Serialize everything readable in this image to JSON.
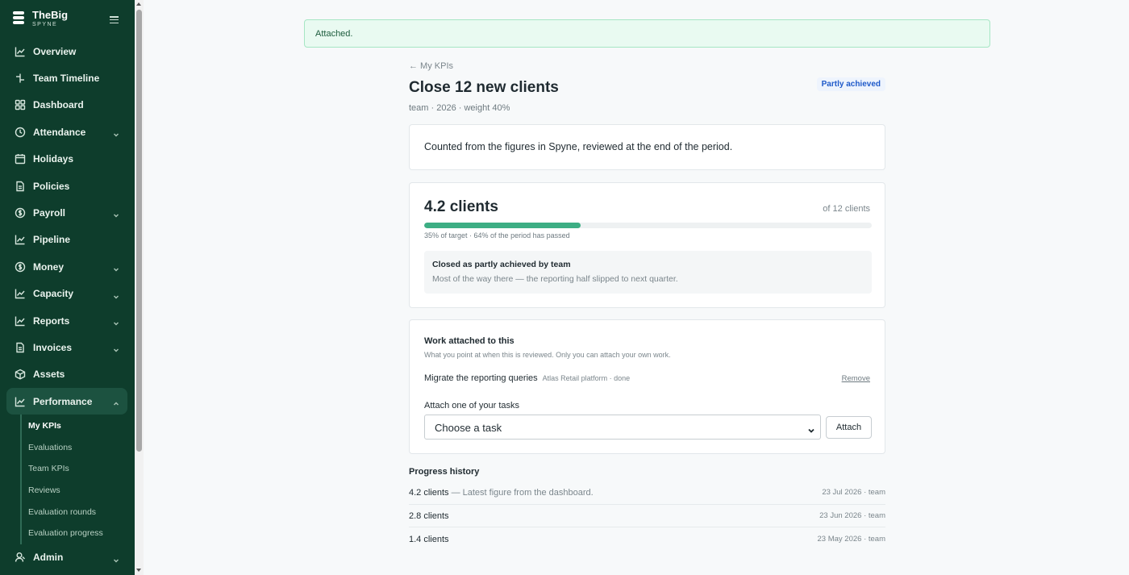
{
  "app": {
    "brand_name": "TheBig",
    "brand_sub": "SPYNE"
  },
  "sidebar": {
    "items": [
      {
        "label": "Overview",
        "icon": "chart-line-icon",
        "chevron": false
      },
      {
        "label": "Team Timeline",
        "icon": "timeline-icon",
        "chevron": false
      },
      {
        "label": "Dashboard",
        "icon": "grid-icon",
        "chevron": false
      },
      {
        "label": "Attendance",
        "icon": "clock-icon",
        "chevron": true
      },
      {
        "label": "Holidays",
        "icon": "calendar-icon",
        "chevron": false
      },
      {
        "label": "Policies",
        "icon": "document-icon",
        "chevron": false
      },
      {
        "label": "Payroll",
        "icon": "dollar-circle-icon",
        "chevron": true
      },
      {
        "label": "Pipeline",
        "icon": "chart-line-icon",
        "chevron": false
      },
      {
        "label": "Money",
        "icon": "dollar-circle-icon",
        "chevron": true
      },
      {
        "label": "Capacity",
        "icon": "chart-line-icon",
        "chevron": true
      },
      {
        "label": "Reports",
        "icon": "chart-line-icon",
        "chevron": true
      },
      {
        "label": "Invoices",
        "icon": "document-icon",
        "chevron": true
      },
      {
        "label": "Assets",
        "icon": "box-icon",
        "chevron": false
      },
      {
        "label": "Performance",
        "icon": "chart-line-icon",
        "chevron": true,
        "active": true
      }
    ],
    "sub_items": [
      {
        "label": "My KPIs",
        "active": true
      },
      {
        "label": "Evaluations"
      },
      {
        "label": "Team KPIs"
      },
      {
        "label": "Reviews"
      },
      {
        "label": "Evaluation rounds"
      },
      {
        "label": "Evaluation progress"
      }
    ],
    "admin": {
      "label": "Admin",
      "icon": "user-icon",
      "chevron": true
    }
  },
  "flash": {
    "message": "Attached."
  },
  "kpi": {
    "back_label": "← My KPIs",
    "title": "Close 12 new clients",
    "meta": "team · 2026 · weight 40%",
    "status": "Partly achieved",
    "description": "Counted from the figures in Spyne, reviewed at the end of the period.",
    "current_value": "4.2 clients",
    "target": "of 12 clients",
    "progress_fraction": 0.35,
    "progress_caption": "35% of target · 64% of the period has passed",
    "closed_title": "Closed as partly achieved by team",
    "closed_text": "Most of the way there — the reporting half slipped to next quarter."
  },
  "work": {
    "title": "Work attached to this",
    "subtitle": "What you point at when this is reviewed. Only you can attach your own work.",
    "attached_name": "Migrate the reporting queries",
    "attached_meta": "Atlas Retail platform · done",
    "remove_label": "Remove",
    "attach_label": "Attach one of your tasks",
    "select_value": "Choose a task",
    "attach_button": "Attach"
  },
  "history": {
    "title": "Progress history",
    "rows": [
      {
        "value": "4.2 clients",
        "note": " — Latest figure from the dashboard.",
        "meta": "23 Jul 2026 · team"
      },
      {
        "value": "2.8 clients",
        "note": "",
        "meta": "23 Jun 2026 · team"
      },
      {
        "value": "1.4 clients",
        "note": "",
        "meta": "23 May 2026 · team"
      }
    ]
  },
  "colors": {
    "sidebar_bg": "#0e3d2c",
    "accent_green": "#3dae84",
    "badge_blue": "#1f5ac9"
  }
}
